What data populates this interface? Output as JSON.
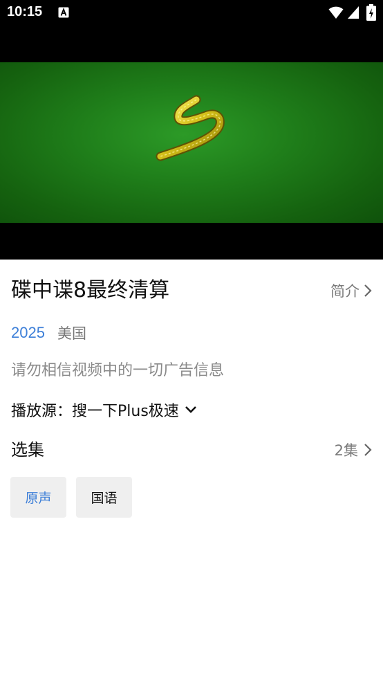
{
  "status_bar": {
    "time": "10:15",
    "app_icon": "font-a-icon",
    "wifi_icon": "wifi-icon",
    "signal_icon": "cellular-signal-icon",
    "battery_icon": "battery-charging-icon"
  },
  "video": {
    "thumbnail_icon": "ribbon-logo-icon",
    "background_color": "#1f7e1a"
  },
  "detail": {
    "title": "碟中谍8最终清算",
    "intro_label": "简介",
    "year": "2025",
    "region": "美国",
    "warning": "请勿相信视频中的一切广告信息",
    "source_label": "播放源：搜一下Plus极速"
  },
  "episodes": {
    "title": "选集",
    "count": "2集",
    "items": [
      {
        "label": "原声",
        "selected": true
      },
      {
        "label": "国语",
        "selected": false
      }
    ]
  },
  "colors": {
    "accent": "#3d7fd8",
    "secondary_text": "#7a7a7a",
    "chip_background": "#efefef"
  }
}
